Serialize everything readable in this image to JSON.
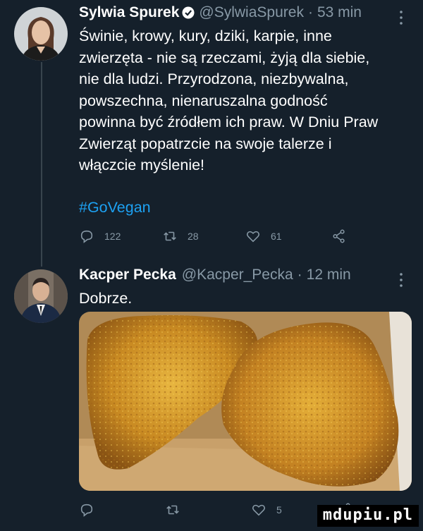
{
  "tweet1": {
    "name": "Sylwia Spurek",
    "handle": "@SylwiaSpurek",
    "dot": "·",
    "time": "53 min",
    "more": "⋮",
    "lines": [
      "Świnie, krowy, kury, dziki, karpie, inne",
      "zwierzęta - nie są rzeczami, żyją dla siebie,",
      "nie dla ludzi. Przyrodzona, niezbywalna,",
      "powszechna, nienaruszalna godność",
      "powinna być źródłem ich praw. W Dniu Praw",
      "Zwierząt popatrzcie na swoje talerze i",
      "włączcie myślenie!"
    ],
    "hashtag": "#GoVegan",
    "replies": "122",
    "retweets": "28",
    "likes": "61",
    "icons": [
      "reply-icon",
      "retweet-icon",
      "like-icon",
      "share-icon"
    ]
  },
  "tweet2": {
    "name": "Kacper Pecka",
    "handle": "@Kacper_Pecka",
    "dot": "·",
    "time": "12 min",
    "more": "⋮",
    "text": "Dobrze.",
    "likes": "5",
    "image_description_icon": "food-photo",
    "icons": [
      "reply-icon",
      "retweet-icon",
      "like-icon",
      "share-icon"
    ]
  },
  "watermark": "mdupiu.pl",
  "colors": {
    "background": "#15202b",
    "text": "#ffffff",
    "muted": "#8899a6",
    "link": "#1da1f2",
    "verified": "#1da1f2"
  }
}
